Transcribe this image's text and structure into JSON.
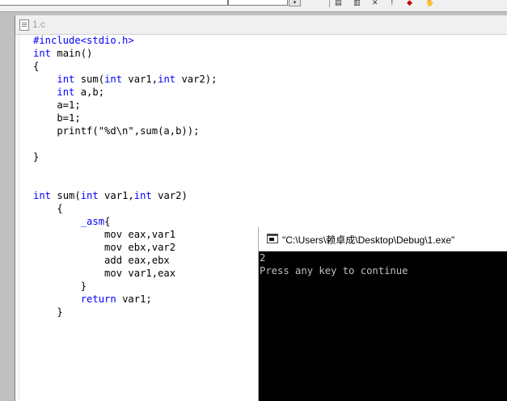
{
  "editor": {
    "tab_title": "1.c",
    "lines": [
      [
        {
          "t": "#include<stdio.h>",
          "kw": true
        }
      ],
      [
        {
          "t": "int",
          "kw": true
        },
        {
          "t": " main()"
        }
      ],
      [
        {
          "t": "{"
        }
      ],
      [
        {
          "t": "    "
        },
        {
          "t": "int",
          "kw": true
        },
        {
          "t": " sum("
        },
        {
          "t": "int",
          "kw": true
        },
        {
          "t": " var1,"
        },
        {
          "t": "int",
          "kw": true
        },
        {
          "t": " var2);"
        }
      ],
      [
        {
          "t": "    "
        },
        {
          "t": "int",
          "kw": true
        },
        {
          "t": " a,b;"
        }
      ],
      [
        {
          "t": "    a=1;"
        }
      ],
      [
        {
          "t": "    b=1;"
        }
      ],
      [
        {
          "t": "    printf(\"%d\\n\",sum(a,b));"
        }
      ],
      [
        {
          "t": ""
        }
      ],
      [
        {
          "t": "}"
        }
      ],
      [
        {
          "t": ""
        }
      ],
      [
        {
          "t": ""
        }
      ],
      [
        {
          "t": "int",
          "kw": true
        },
        {
          "t": " sum("
        },
        {
          "t": "int",
          "kw": true
        },
        {
          "t": " var1,"
        },
        {
          "t": "int",
          "kw": true
        },
        {
          "t": " var2)"
        }
      ],
      [
        {
          "t": "    {"
        }
      ],
      [
        {
          "t": "        "
        },
        {
          "t": "_asm",
          "kw": true
        },
        {
          "t": "{"
        }
      ],
      [
        {
          "t": "            mov eax,var1"
        }
      ],
      [
        {
          "t": "            mov ebx,var2"
        }
      ],
      [
        {
          "t": "            add eax,ebx"
        }
      ],
      [
        {
          "t": "            mov var1,eax"
        }
      ],
      [
        {
          "t": "        }"
        }
      ],
      [
        {
          "t": "        "
        },
        {
          "t": "return",
          "kw": true
        },
        {
          "t": " var1;"
        }
      ],
      [
        {
          "t": "    }"
        }
      ]
    ]
  },
  "console": {
    "title": "\"C:\\Users\\赖卓成\\Desktop\\Debug\\1.exe\"",
    "output_lines": [
      "2",
      "Press any key to continue"
    ]
  },
  "colors": {
    "keyword": "#0000ff",
    "console_bg": "#000000",
    "console_text": "#c0c0c0"
  }
}
